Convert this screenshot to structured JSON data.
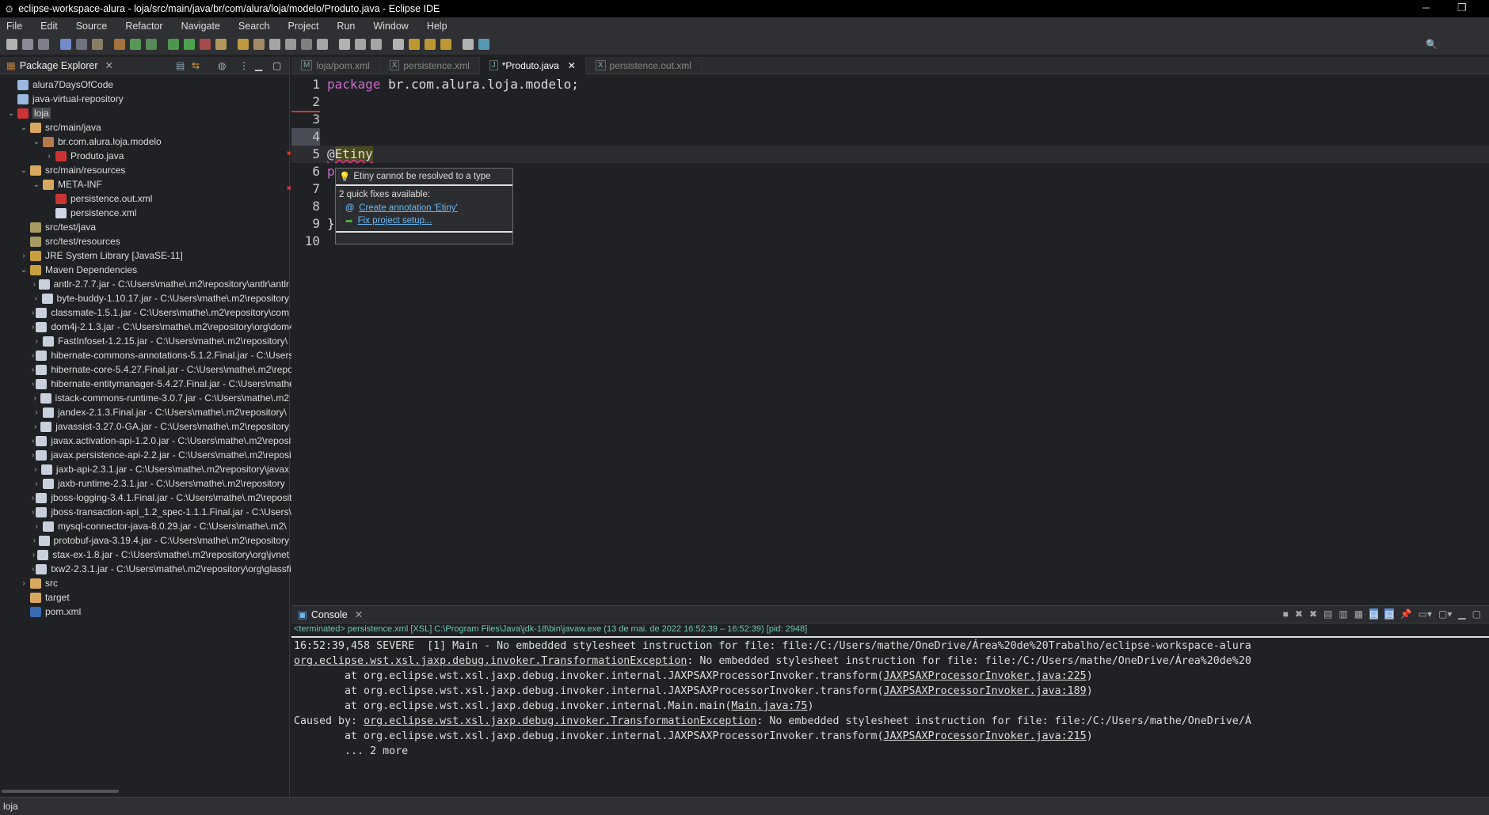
{
  "window": {
    "title": "eclipse-workspace-alura - loja/src/main/java/br/com/alura/loja/modelo/Produto.java - Eclipse IDE"
  },
  "menu": [
    "File",
    "Edit",
    "Source",
    "Refactor",
    "Navigate",
    "Search",
    "Project",
    "Run",
    "Window",
    "Help"
  ],
  "explorer": {
    "title": "Package Explorer",
    "items": [
      {
        "label": "alura7DaysOfCode",
        "depth": 0,
        "chev": "",
        "icon": "project-icon",
        "color": "#9ab8e0"
      },
      {
        "label": "java-virtual-repository",
        "depth": 0,
        "chev": "",
        "icon": "project-icon",
        "color": "#9ab8e0"
      },
      {
        "label": "loja",
        "depth": 0,
        "chev": "v",
        "icon": "maven-project-error-icon",
        "color": "#c33",
        "selected": true
      },
      {
        "label": "src/main/java",
        "depth": 1,
        "chev": "v",
        "icon": "source-folder-error-icon",
        "color": "#d9a860"
      },
      {
        "label": "br.com.alura.loja.modelo",
        "depth": 2,
        "chev": "v",
        "icon": "package-error-icon",
        "color": "#b57a4a"
      },
      {
        "label": "Produto.java",
        "depth": 3,
        "chev": ">",
        "icon": "java-file-error-icon",
        "color": "#c33"
      },
      {
        "label": "src/main/resources",
        "depth": 1,
        "chev": "v",
        "icon": "source-folder-error-icon",
        "color": "#d9a860"
      },
      {
        "label": "META-INF",
        "depth": 2,
        "chev": "v",
        "icon": "folder-error-icon",
        "color": "#d9a860"
      },
      {
        "label": "persistence.out.xml",
        "depth": 3,
        "chev": "",
        "icon": "xml-file-error-icon",
        "color": "#c33"
      },
      {
        "label": "persistence.xml",
        "depth": 3,
        "chev": "",
        "icon": "xml-file-icon",
        "color": "#d0d8e8"
      },
      {
        "label": "src/test/java",
        "depth": 1,
        "chev": "",
        "icon": "source-folder-icon",
        "color": "#a89a60"
      },
      {
        "label": "src/test/resources",
        "depth": 1,
        "chev": "",
        "icon": "source-folder-icon",
        "color": "#a89a60"
      },
      {
        "label": "JRE System Library [JavaSE-11]",
        "depth": 1,
        "chev": ">",
        "icon": "library-icon",
        "color": "#c9a040"
      },
      {
        "label": "Maven Dependencies",
        "depth": 1,
        "chev": "v",
        "icon": "library-icon",
        "color": "#c9a040"
      },
      {
        "label": "antlr-2.7.7.jar - C:\\Users\\mathe\\.m2\\repository\\antlr\\antlr",
        "depth": 2,
        "chev": ">",
        "icon": "jar-icon",
        "color": "#c8d0dc"
      },
      {
        "label": "byte-buddy-1.10.17.jar - C:\\Users\\mathe\\.m2\\repository",
        "depth": 2,
        "chev": ">",
        "icon": "jar-icon",
        "color": "#c8d0dc"
      },
      {
        "label": "classmate-1.5.1.jar - C:\\Users\\mathe\\.m2\\repository\\com",
        "depth": 2,
        "chev": ">",
        "icon": "jar-icon",
        "color": "#c8d0dc"
      },
      {
        "label": "dom4j-2.1.3.jar - C:\\Users\\mathe\\.m2\\repository\\org\\dom4j",
        "depth": 2,
        "chev": ">",
        "icon": "jar-icon",
        "color": "#c8d0dc"
      },
      {
        "label": "FastInfoset-1.2.15.jar - C:\\Users\\mathe\\.m2\\repository\\",
        "depth": 2,
        "chev": ">",
        "icon": "jar-icon",
        "color": "#c8d0dc"
      },
      {
        "label": "hibernate-commons-annotations-5.1.2.Final.jar - C:\\Users",
        "depth": 2,
        "chev": ">",
        "icon": "jar-icon",
        "color": "#c8d0dc"
      },
      {
        "label": "hibernate-core-5.4.27.Final.jar - C:\\Users\\mathe\\.m2\\repository",
        "depth": 2,
        "chev": ">",
        "icon": "jar-icon",
        "color": "#c8d0dc"
      },
      {
        "label": "hibernate-entitymanager-5.4.27.Final.jar - C:\\Users\\mathe",
        "depth": 2,
        "chev": ">",
        "icon": "jar-icon",
        "color": "#c8d0dc"
      },
      {
        "label": "istack-commons-runtime-3.0.7.jar - C:\\Users\\mathe\\.m2",
        "depth": 2,
        "chev": ">",
        "icon": "jar-icon",
        "color": "#c8d0dc"
      },
      {
        "label": "jandex-2.1.3.Final.jar - C:\\Users\\mathe\\.m2\\repository\\",
        "depth": 2,
        "chev": ">",
        "icon": "jar-icon",
        "color": "#c8d0dc"
      },
      {
        "label": "javassist-3.27.0-GA.jar - C:\\Users\\mathe\\.m2\\repository",
        "depth": 2,
        "chev": ">",
        "icon": "jar-icon",
        "color": "#c8d0dc"
      },
      {
        "label": "javax.activation-api-1.2.0.jar - C:\\Users\\mathe\\.m2\\repository",
        "depth": 2,
        "chev": ">",
        "icon": "jar-icon",
        "color": "#c8d0dc"
      },
      {
        "label": "javax.persistence-api-2.2.jar - C:\\Users\\mathe\\.m2\\repository",
        "depth": 2,
        "chev": ">",
        "icon": "jar-icon",
        "color": "#c8d0dc"
      },
      {
        "label": "jaxb-api-2.3.1.jar - C:\\Users\\mathe\\.m2\\repository\\javax",
        "depth": 2,
        "chev": ">",
        "icon": "jar-icon",
        "color": "#c8d0dc"
      },
      {
        "label": "jaxb-runtime-2.3.1.jar - C:\\Users\\mathe\\.m2\\repository",
        "depth": 2,
        "chev": ">",
        "icon": "jar-icon",
        "color": "#c8d0dc"
      },
      {
        "label": "jboss-logging-3.4.1.Final.jar - C:\\Users\\mathe\\.m2\\repository",
        "depth": 2,
        "chev": ">",
        "icon": "jar-icon",
        "color": "#c8d0dc"
      },
      {
        "label": "jboss-transaction-api_1.2_spec-1.1.1.Final.jar - C:\\Users\\",
        "depth": 2,
        "chev": ">",
        "icon": "jar-icon",
        "color": "#c8d0dc"
      },
      {
        "label": "mysql-connector-java-8.0.29.jar - C:\\Users\\mathe\\.m2\\",
        "depth": 2,
        "chev": ">",
        "icon": "jar-icon",
        "color": "#c8d0dc"
      },
      {
        "label": "protobuf-java-3.19.4.jar - C:\\Users\\mathe\\.m2\\repository",
        "depth": 2,
        "chev": ">",
        "icon": "jar-icon",
        "color": "#c8d0dc"
      },
      {
        "label": "stax-ex-1.8.jar - C:\\Users\\mathe\\.m2\\repository\\org\\jvnet",
        "depth": 2,
        "chev": ">",
        "icon": "jar-icon",
        "color": "#c8d0dc"
      },
      {
        "label": "txw2-2.3.1.jar - C:\\Users\\mathe\\.m2\\repository\\org\\glassfish",
        "depth": 2,
        "chev": ">",
        "icon": "jar-icon",
        "color": "#c8d0dc"
      },
      {
        "label": "src",
        "depth": 1,
        "chev": ">",
        "icon": "folder-error-icon",
        "color": "#d9a860"
      },
      {
        "label": "target",
        "depth": 1,
        "chev": "",
        "icon": "folder-icon",
        "color": "#d9a860"
      },
      {
        "label": "pom.xml",
        "depth": 1,
        "chev": "",
        "icon": "maven-pom-icon",
        "color": "#3a6ab0"
      }
    ]
  },
  "editor": {
    "tabs": [
      {
        "label": "loja/pom.xml",
        "active": false
      },
      {
        "label": "persistence.xml",
        "active": false
      },
      {
        "label": "*Produto.java",
        "active": true
      },
      {
        "label": "persistence.out.xml",
        "active": false
      }
    ],
    "lines": [
      {
        "n": "1",
        "kw": "package",
        "text": " br.com.alura.loja.modelo;"
      },
      {
        "n": "2",
        "kw": "",
        "text": ""
      },
      {
        "n": "3",
        "kw": "",
        "text": ""
      },
      {
        "n": "4",
        "kw": "",
        "text": ""
      },
      {
        "n": "5",
        "kw": "",
        "text": "@Etiny"
      },
      {
        "n": "6",
        "kw": "p",
        "text": ""
      },
      {
        "n": "7",
        "kw": "",
        "text": ""
      },
      {
        "n": "8",
        "kw": "",
        "text": ""
      },
      {
        "n": "9",
        "kw": "",
        "text": "}"
      },
      {
        "n": "10",
        "kw": "",
        "text": ""
      }
    ],
    "hover": {
      "message": "Etiny cannot be resolved to a type",
      "fixes_header": "2 quick fixes available:",
      "fixes": [
        "Create annotation 'Etiny'",
        "Fix project setup..."
      ]
    }
  },
  "console": {
    "title": "Console",
    "process": "<terminated> persistence.xml [XSL] C:\\Program Files\\Java\\jdk-18\\bin\\javaw.exe  (13 de mai. de 2022 16:52:39 – 16:52:39) [pid: 2948]",
    "lines": [
      {
        "pre": "16:52:39,458 SEVERE  [1] Main - No embedded stylesheet instruction for file: file:/C:/Users/mathe/OneDrive/Área%20de%20Trabalho/eclipse-workspace-alura",
        "link": "",
        "post": ""
      },
      {
        "pre": "",
        "link": "org.eclipse.wst.xsl.jaxp.debug.invoker.TransformationException",
        "post": ": No embedded stylesheet instruction for file: file:/C:/Users/mathe/OneDrive/Área%20de%20"
      },
      {
        "pre": "        at org.eclipse.wst.xsl.jaxp.debug.invoker.internal.JAXPSAXProcessorInvoker.transform(",
        "link": "JAXPSAXProcessorInvoker.java:225",
        "post": ")"
      },
      {
        "pre": "        at org.eclipse.wst.xsl.jaxp.debug.invoker.internal.JAXPSAXProcessorInvoker.transform(",
        "link": "JAXPSAXProcessorInvoker.java:189",
        "post": ")"
      },
      {
        "pre": "        at org.eclipse.wst.xsl.jaxp.debug.invoker.internal.Main.main(",
        "link": "Main.java:75",
        "post": ")"
      },
      {
        "pre": "Caused by: ",
        "link": "org.eclipse.wst.xsl.jaxp.debug.invoker.TransformationException",
        "post": ": No embedded stylesheet instruction for file: file:/C:/Users/mathe/OneDrive/Á"
      },
      {
        "pre": "        at org.eclipse.wst.xsl.jaxp.debug.invoker.internal.JAXPSAXProcessorInvoker.transform(",
        "link": "JAXPSAXProcessorInvoker.java:215",
        "post": ")"
      },
      {
        "pre": "        ... 2 more",
        "link": "",
        "post": ""
      }
    ]
  },
  "status": {
    "text": "loja"
  }
}
